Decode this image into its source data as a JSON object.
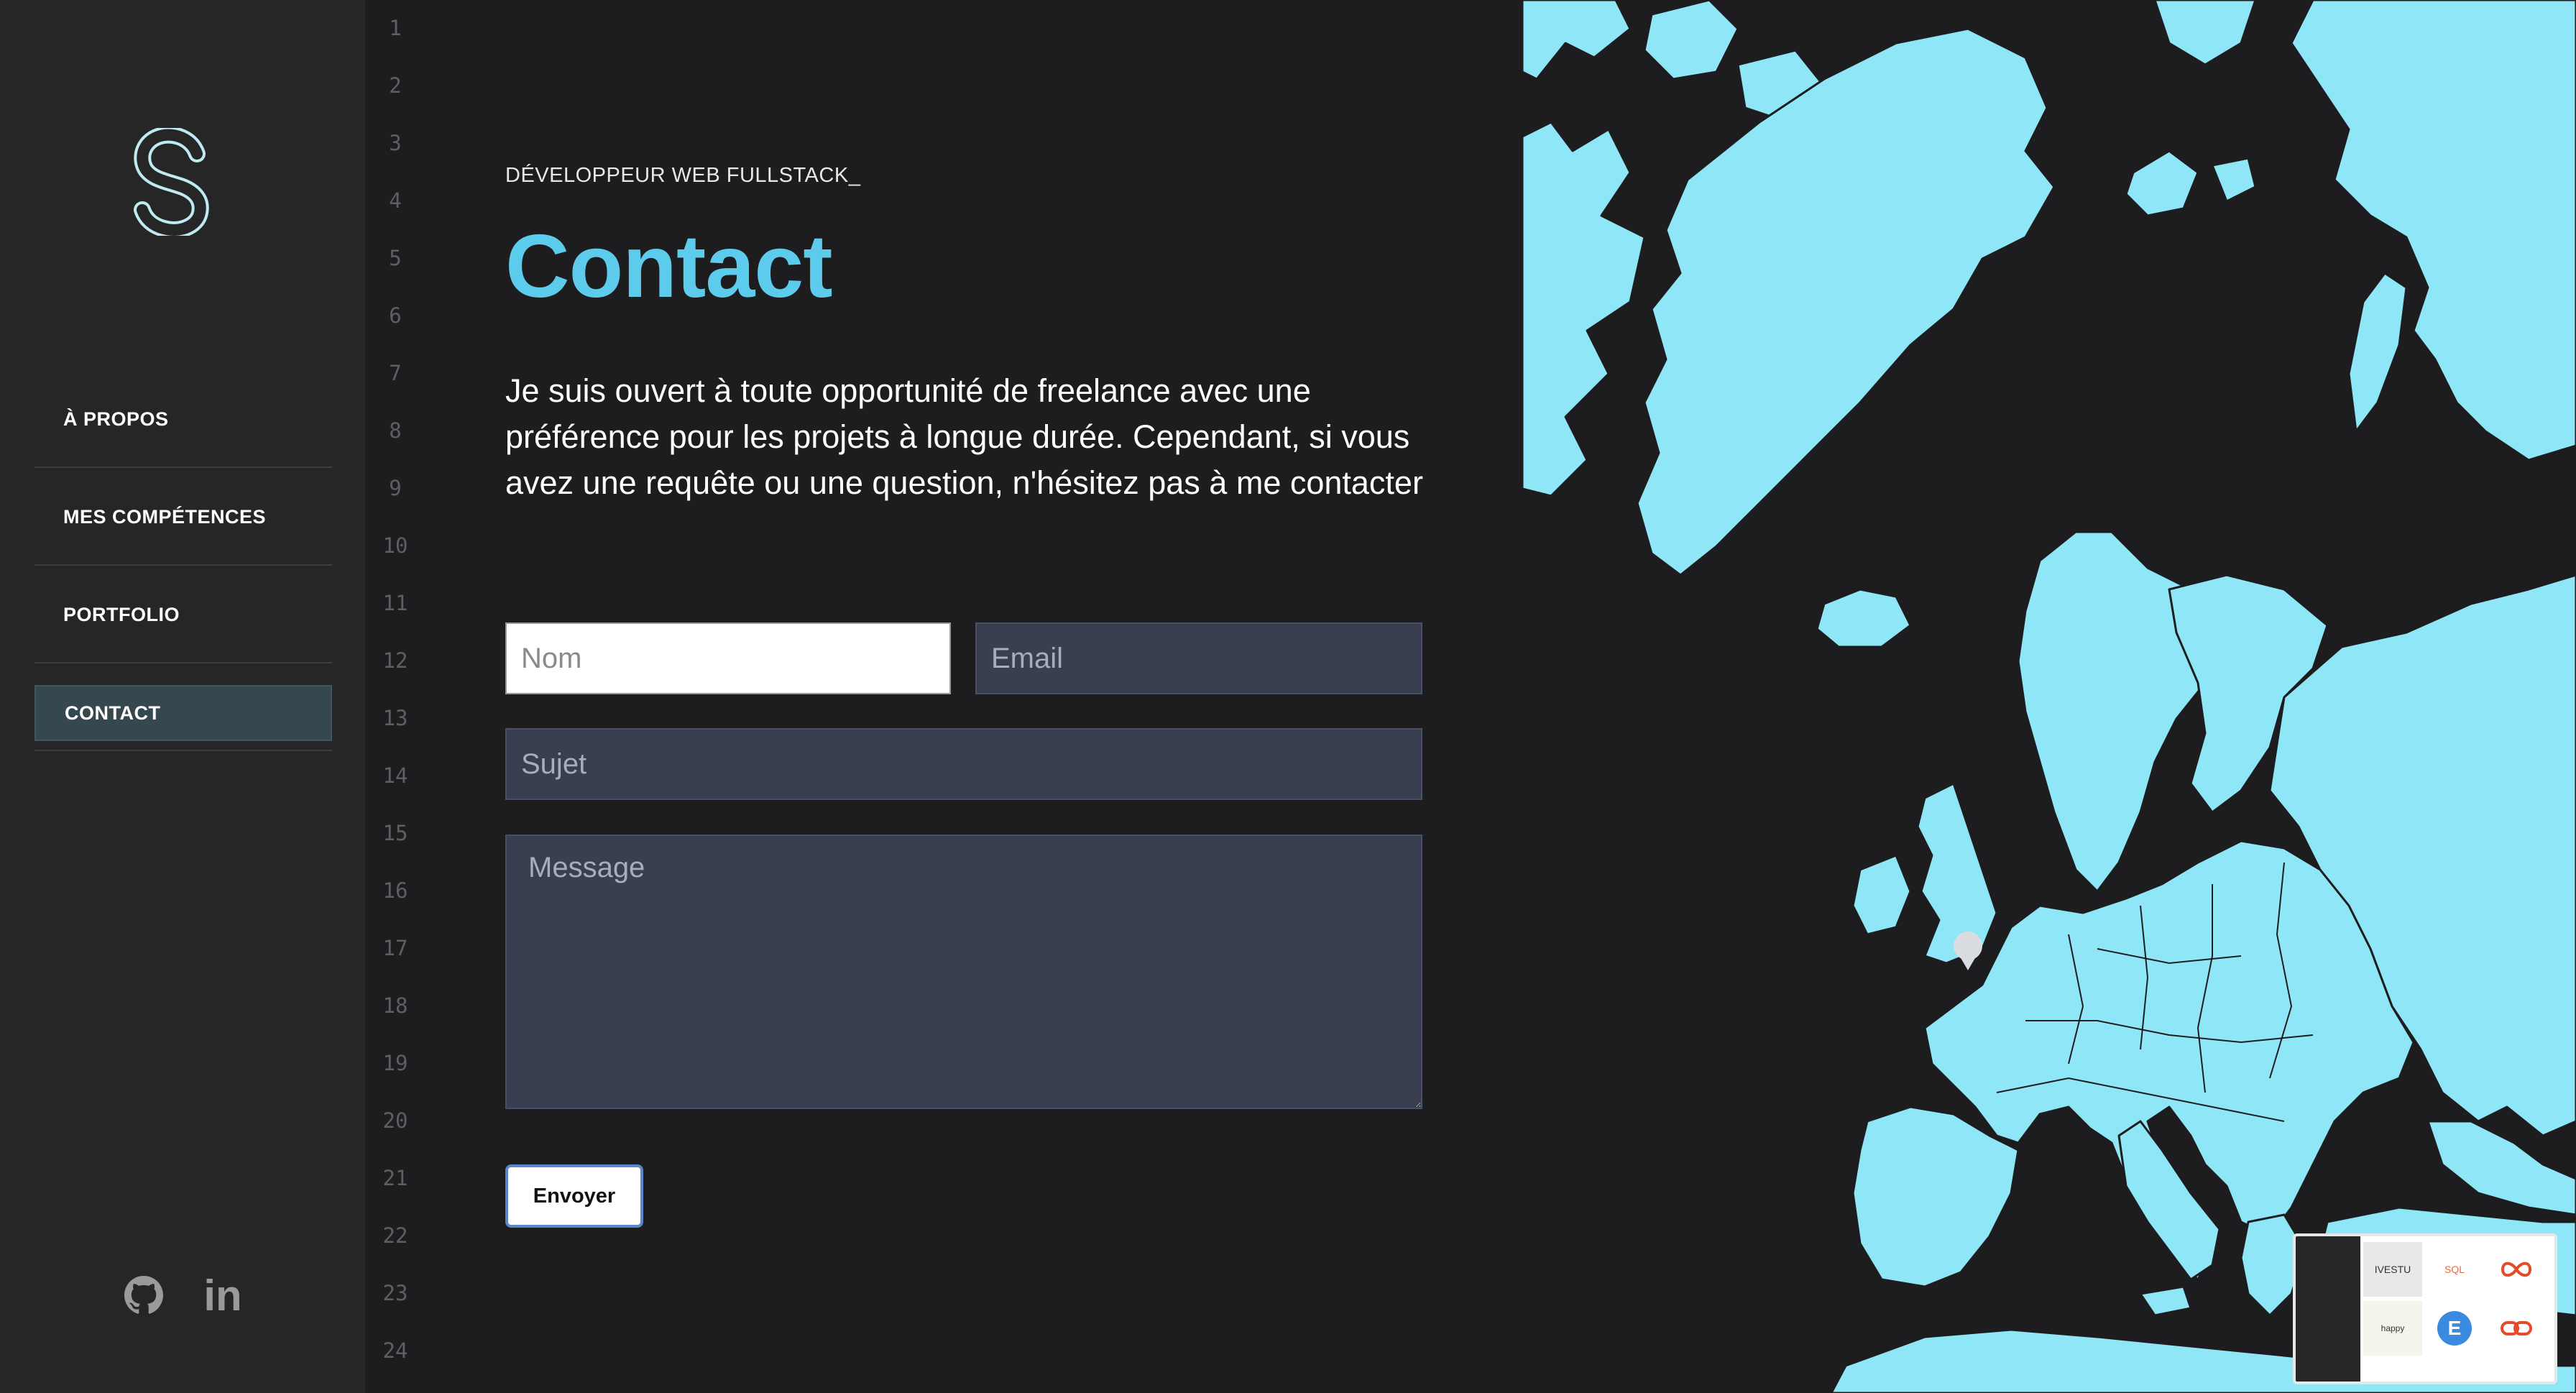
{
  "brand": {
    "logo_letter": "S"
  },
  "nav": {
    "items": [
      {
        "label": "À PROPOS"
      },
      {
        "label": "MES COMPÉTENCES"
      },
      {
        "label": "PORTFOLIO"
      },
      {
        "label": "CONTACT",
        "active": true
      }
    ]
  },
  "socials": [
    {
      "icon": "github-icon"
    },
    {
      "icon": "linkedin-icon",
      "label": "in"
    }
  ],
  "line_numbers": [
    "1",
    "2",
    "3",
    "4",
    "5",
    "6",
    "7",
    "8",
    "9",
    "10",
    "11",
    "12",
    "13",
    "14",
    "15",
    "16",
    "17",
    "18",
    "19",
    "20",
    "21",
    "22",
    "23",
    "24"
  ],
  "header": {
    "tagline": "DÉVELOPPEUR WEB FULLSTACK_",
    "title": "Contact",
    "description": "Je suis ouvert à toute opportunité de freelance avec une préférence pour les projets à longue durée. Cependant, si vous avez une requête ou une question, n'hésitez pas à me contacter"
  },
  "form": {
    "name_placeholder": "Nom",
    "email_placeholder": "Email",
    "subject_placeholder": "Sujet",
    "message_placeholder": "Message",
    "submit_label": "Envoyer"
  },
  "colors": {
    "accent": "#5ccbec",
    "map_land": "#8ee6f6",
    "sidebar_bg": "#262626",
    "active_nav_bg": "#35474f",
    "input_bg": "#393f50"
  },
  "thumbnail": {
    "tiles": [
      "IVESTU",
      "SQL",
      "infinity-icon",
      "happy",
      "E",
      "link-icon"
    ]
  }
}
